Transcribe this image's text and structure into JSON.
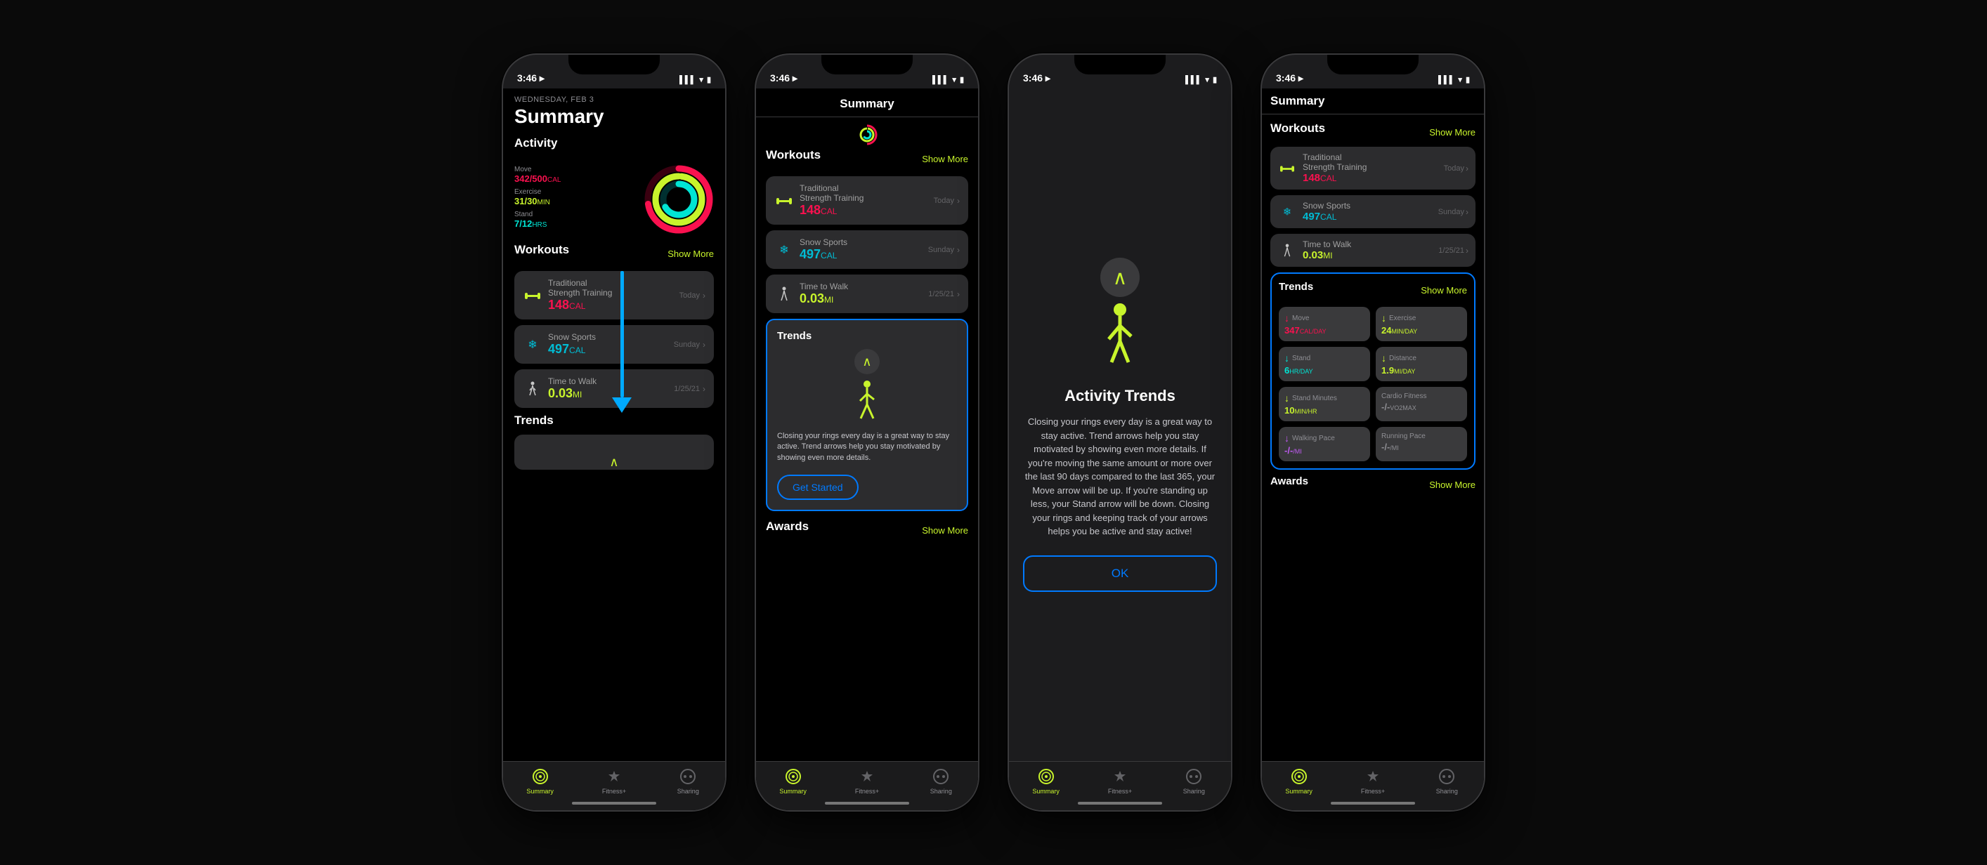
{
  "phones": [
    {
      "id": "phone1",
      "statusBar": {
        "time": "3:46",
        "signal": "▌▌▌",
        "wifi": "▾",
        "battery": "▮"
      },
      "header": {
        "date": "WEDNESDAY, FEB 3",
        "title": "Summary"
      },
      "activity": {
        "sectionLabel": "Activity",
        "move": "342/500",
        "moveUnit": "CAL",
        "exercise": "31/30",
        "exerciseUnit": "MIN",
        "stand": "7/12",
        "standUnit": "HRS"
      },
      "workouts": {
        "label": "Workouts",
        "showMore": "Show More",
        "items": [
          {
            "name": "Traditional\nStrength Training",
            "value": "148",
            "unit": "CAL",
            "date": "Today",
            "color": "green"
          },
          {
            "name": "Snow Sports",
            "value": "497",
            "unit": "CAL",
            "date": "Sunday",
            "color": "teal"
          },
          {
            "name": "Time to Walk",
            "value": "0.03",
            "unit": "MI",
            "date": "1/25/21",
            "color": "green"
          }
        ]
      },
      "trends": {
        "label": "Trends"
      },
      "tabBar": {
        "items": [
          {
            "label": "Summary",
            "active": true
          },
          {
            "label": "Fitness+",
            "active": false
          },
          {
            "label": "Sharing",
            "active": false
          }
        ]
      }
    },
    {
      "id": "phone2",
      "statusBar": {
        "time": "3:46"
      },
      "pageTitle": "Summary",
      "workouts": {
        "label": "Workouts",
        "showMore": "Show More",
        "items": [
          {
            "name": "Traditional\nStrength Training",
            "value": "148",
            "unit": "CAL",
            "date": "Today",
            "color": "green"
          },
          {
            "name": "Snow Sports",
            "value": "497",
            "unit": "CAL",
            "date": "Sunday",
            "color": "teal"
          },
          {
            "name": "Time to Walk",
            "value": "0.03",
            "unit": "MI",
            "date": "1/25/21",
            "color": "green"
          }
        ]
      },
      "trends": {
        "label": "Trends",
        "highlighted": true,
        "description": "Closing your rings every day is a great way to stay active. Trend arrows help you stay motivated by showing even more details.",
        "getStarted": "Get Started"
      },
      "awards": {
        "label": "Awards",
        "showMore": "Show More"
      },
      "tabBar": {
        "items": [
          {
            "label": "Summary",
            "active": true
          },
          {
            "label": "Fitness+",
            "active": false
          },
          {
            "label": "Sharing",
            "active": false
          }
        ]
      }
    },
    {
      "id": "phone3",
      "statusBar": {
        "time": "3:46"
      },
      "overlay": {
        "title": "Activity Trends",
        "description": "Closing your rings every day is a great way to stay active. Trend arrows help you stay motivated by showing even more details. If you're moving the same amount or more over the last 90 days compared to the last 365, your Move arrow will be up. If you're standing up less, your Stand arrow will be down. Closing your rings and keeping track of your arrows helps you be active and stay active!",
        "okButton": "OK"
      },
      "tabBar": {
        "items": [
          {
            "label": "Summary",
            "active": true
          },
          {
            "label": "Fitness+",
            "active": false
          },
          {
            "label": "Sharing",
            "active": false
          }
        ]
      }
    },
    {
      "id": "phone4",
      "statusBar": {
        "time": "3:46"
      },
      "pageTitle": "Summary",
      "workouts": {
        "label": "Workouts",
        "showMore": "Show More",
        "items": [
          {
            "name": "Traditional\nStrength Training",
            "value": "148",
            "unit": "CAL",
            "date": "Today",
            "color": "green"
          },
          {
            "name": "Snow Sports",
            "value": "497",
            "unit": "CAL",
            "date": "Sunday",
            "color": "teal"
          },
          {
            "name": "Time to Walk",
            "value": "0.03",
            "unit": "MI",
            "date": "1/25/21",
            "color": "green"
          }
        ]
      },
      "trends": {
        "label": "Trends",
        "showMore": "Show More",
        "highlighted": true,
        "items": [
          {
            "label": "Move",
            "value": "347CAL/DAY",
            "arrowType": "down-red",
            "color": "red"
          },
          {
            "label": "Exercise",
            "value": "24MIN/DAY",
            "arrowType": "down-green",
            "color": "green"
          },
          {
            "label": "Stand",
            "value": "6HR/DAY",
            "arrowType": "down-teal",
            "color": "teal"
          },
          {
            "label": "Distance",
            "value": "1.9MI/DAY",
            "arrowType": "down-green",
            "color": "green"
          },
          {
            "label": "Stand Minutes",
            "value": "10MIN/HR",
            "arrowType": "down-green",
            "color": "green"
          },
          {
            "label": "Cardio Fitness",
            "value": "-/-VO2MAX",
            "arrowType": "none",
            "color": "gray"
          },
          {
            "label": "Walking Pace",
            "value": "-/-/MI",
            "arrowType": "down-purple",
            "color": "purple"
          },
          {
            "label": "Running Pace",
            "value": "-/-/MI",
            "arrowType": "none",
            "color": "gray"
          }
        ]
      },
      "awards": {
        "label": "Awards",
        "showMore": "Show More"
      },
      "tabBar": {
        "items": [
          {
            "label": "Summary",
            "active": true
          },
          {
            "label": "Fitness+",
            "active": false
          },
          {
            "label": "Sharing",
            "active": false
          }
        ]
      }
    }
  ],
  "icons": {
    "summary": "⊙",
    "fitness": "♦",
    "sharing": "◎",
    "chevronRight": "›",
    "chevronDown": "˅",
    "arrowDown": "↓",
    "arrowUp": "↑"
  }
}
